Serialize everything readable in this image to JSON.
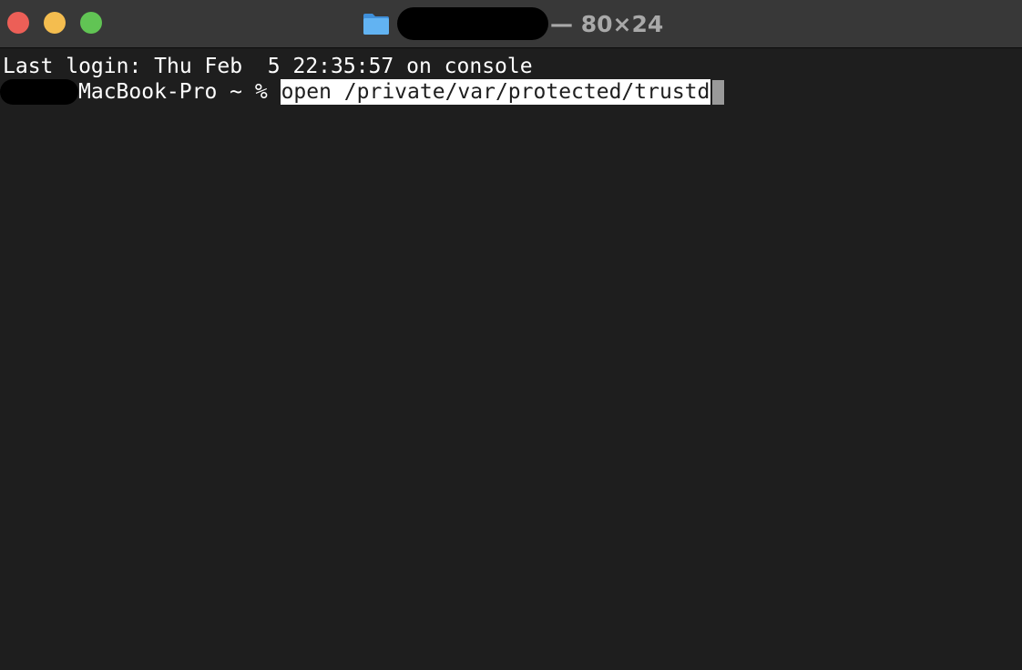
{
  "window": {
    "title_suffix": "— 80×24",
    "icons": {
      "folder": "folder-icon"
    },
    "traffic_lights": {
      "close_color": "#ec5f57",
      "minimize_color": "#f4bd4f",
      "zoom_color": "#61c454"
    }
  },
  "terminal": {
    "last_login": "Last login: Thu Feb  5 22:35:57 on console",
    "prompt": "MacBook-Pro ~ % ",
    "command": "open /private/var/protected/trustd"
  },
  "colors": {
    "background": "#1e1e1e",
    "titlebar": "#383838",
    "text": "#ffffff",
    "selection": "#ffffff",
    "cursor": "#9a9a9a",
    "folder": "#5aaeef"
  }
}
